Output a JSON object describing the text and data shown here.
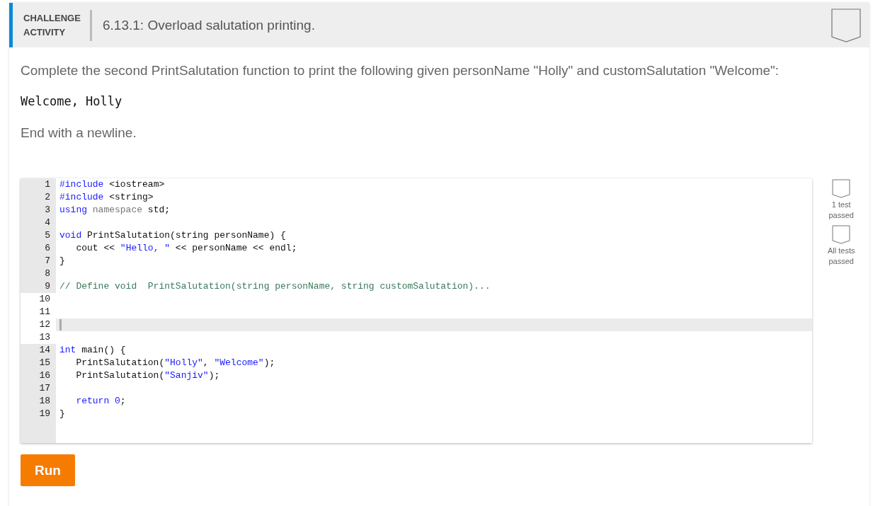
{
  "header": {
    "label_lines": [
      "CHALLENGE",
      "ACTIVITY"
    ],
    "title": "6.13.1: Overload salutation printing.",
    "completed": false
  },
  "instructions": {
    "prompt": "Complete the second PrintSalutation function to print the following given personName \"Holly\" and customSalutation \"Welcome\":",
    "expected_output": "Welcome, Holly",
    "note": "End with a newline."
  },
  "editor": {
    "lines": [
      {
        "number": "1",
        "editable": false,
        "active": false,
        "tokens": [
          {
            "kind": "keyword",
            "text": "#include"
          },
          {
            "kind": "plain",
            "text": " <iostream>"
          }
        ]
      },
      {
        "number": "2",
        "editable": false,
        "active": false,
        "tokens": [
          {
            "kind": "keyword",
            "text": "#include"
          },
          {
            "kind": "plain",
            "text": " <string>"
          }
        ]
      },
      {
        "number": "3",
        "editable": false,
        "active": false,
        "tokens": [
          {
            "kind": "keyword",
            "text": "using"
          },
          {
            "kind": "muted",
            "text": " namespace"
          },
          {
            "kind": "plain",
            "text": " std;"
          }
        ]
      },
      {
        "number": "4",
        "editable": false,
        "active": false
      },
      {
        "number": "5",
        "editable": false,
        "active": false,
        "tokens": [
          {
            "kind": "keyword",
            "text": "void"
          },
          {
            "kind": "plain",
            "text": " PrintSalutation(string personName) {"
          }
        ]
      },
      {
        "number": "6",
        "editable": false,
        "active": false,
        "tokens": [
          {
            "kind": "plain",
            "text": "   cout << "
          },
          {
            "kind": "string",
            "text": "\"Hello, \""
          },
          {
            "kind": "plain",
            "text": " << personName << endl;"
          }
        ]
      },
      {
        "number": "7",
        "editable": false,
        "active": false,
        "tokens": [
          {
            "kind": "plain",
            "text": "}"
          }
        ]
      },
      {
        "number": "8",
        "editable": false,
        "active": false
      },
      {
        "number": "9",
        "editable": false,
        "active": false,
        "tokens": [
          {
            "kind": "comment",
            "text": "// Define void  PrintSalutation(string personName, string customSalutation)..."
          }
        ]
      },
      {
        "number": "10",
        "editable": true,
        "active": false
      },
      {
        "number": "11",
        "editable": true,
        "active": false
      },
      {
        "number": "12",
        "editable": true,
        "active": true
      },
      {
        "number": "13",
        "editable": true,
        "active": false
      },
      {
        "number": "14",
        "editable": false,
        "active": false,
        "tokens": [
          {
            "kind": "keyword",
            "text": "int"
          },
          {
            "kind": "plain",
            "text": " main() {"
          }
        ]
      },
      {
        "number": "15",
        "editable": false,
        "active": false,
        "tokens": [
          {
            "kind": "plain",
            "text": "   PrintSalutation("
          },
          {
            "kind": "string",
            "text": "\"Holly\""
          },
          {
            "kind": "plain",
            "text": ", "
          },
          {
            "kind": "string",
            "text": "\"Welcome\""
          },
          {
            "kind": "plain",
            "text": ");"
          }
        ]
      },
      {
        "number": "16",
        "editable": false,
        "active": false,
        "tokens": [
          {
            "kind": "plain",
            "text": "   PrintSalutation("
          },
          {
            "kind": "string",
            "text": "\"Sanjiv\""
          },
          {
            "kind": "plain",
            "text": ");"
          }
        ]
      },
      {
        "number": "17",
        "editable": false,
        "active": false
      },
      {
        "number": "18",
        "editable": false,
        "active": false,
        "tokens": [
          {
            "kind": "keyword",
            "text": "   return"
          },
          {
            "kind": "number",
            "text": " 0"
          },
          {
            "kind": "plain",
            "text": ";"
          }
        ]
      },
      {
        "number": "19",
        "editable": false,
        "active": false,
        "tokens": [
          {
            "kind": "plain",
            "text": "}"
          }
        ]
      }
    ]
  },
  "tests": [
    {
      "label_lines": [
        "1 test",
        "passed"
      ],
      "passed": false
    },
    {
      "label_lines": [
        "All tests",
        "passed"
      ],
      "passed": false
    }
  ],
  "run_button": "Run"
}
